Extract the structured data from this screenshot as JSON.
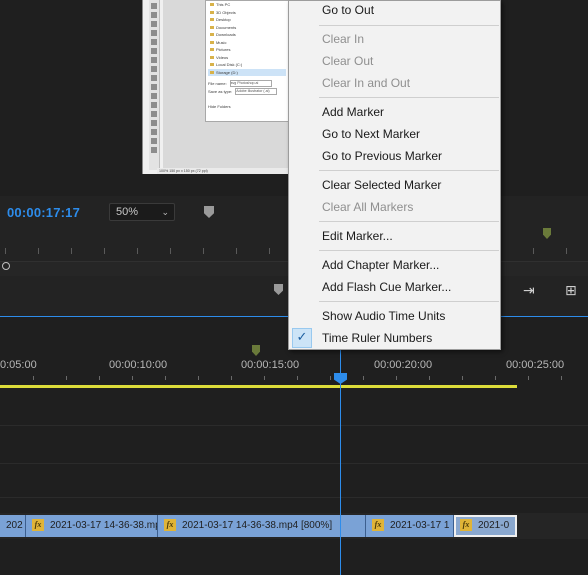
{
  "monitor": {
    "timecode": "00:00:17:17",
    "zoom": "50%",
    "preview": {
      "nav_items": [
        "This PC",
        "3D Objects",
        "Desktop",
        "Documents",
        "Downloads",
        "Music",
        "Pictures",
        "Videos",
        "Local Disk (C:)",
        "Storage (D:)"
      ],
      "selected_nav_index": 9,
      "file_name_label": "File name:",
      "file_name_value": "svg Photoshop.ai",
      "save_type_label": "Save as type:",
      "save_type_value": "Adobe Illustrator (.ai)",
      "hide_folders": "Hide Folders",
      "status_text": "100% 150 px x 150 px (72 ppi)"
    }
  },
  "timeline": {
    "time_labels": [
      "0:05:00",
      "00:00:10:00",
      "00:00:15:00",
      "00:00:20:00",
      "00:00:25:00"
    ],
    "clips": [
      {
        "label": "202",
        "fx": false
      },
      {
        "label": "2021-03-17 14-36-38.mp",
        "fx": true
      },
      {
        "label": "2021-03-17 14-36-38.mp4 [800%]",
        "fx": true
      },
      {
        "label": "2021-03-17 1",
        "fx": true
      },
      {
        "label": "2021-0",
        "fx": true,
        "selected": true
      }
    ],
    "fx_label": "fx"
  },
  "context_menu": {
    "items": [
      {
        "label": "Go to Out",
        "disabled": false
      },
      {
        "label": "Clear In",
        "disabled": true
      },
      {
        "label": "Clear Out",
        "disabled": true
      },
      {
        "label": "Clear In and Out",
        "disabled": true
      },
      {
        "label": "Add Marker",
        "disabled": false
      },
      {
        "label": "Go to Next Marker",
        "disabled": false
      },
      {
        "label": "Go to Previous Marker",
        "disabled": false
      },
      {
        "label": "Clear Selected Marker",
        "disabled": false
      },
      {
        "label": "Clear All Markers",
        "disabled": true
      },
      {
        "label": "Edit Marker...",
        "disabled": false
      },
      {
        "label": "Add Chapter Marker...",
        "disabled": false
      },
      {
        "label": "Add Flash Cue Marker...",
        "disabled": false
      },
      {
        "label": "Show Audio Time Units",
        "disabled": false
      },
      {
        "label": "Time Ruler Numbers",
        "disabled": false,
        "checked": true
      }
    ],
    "check_glyph": "✓"
  },
  "colors": {
    "accent_blue": "#2d8ceb",
    "clip_blue": "#7aa2d6",
    "work_area_yellow": "#dcdc3a",
    "fx_badge": "#e0b437",
    "menu_bg": "#f2f2f2"
  },
  "icons": {
    "zoom_dropdown": "chevron-down-icon",
    "transport_insert": "insert-icon",
    "transport_export_frame": "export-frame-icon",
    "marker": "marker-icon"
  }
}
